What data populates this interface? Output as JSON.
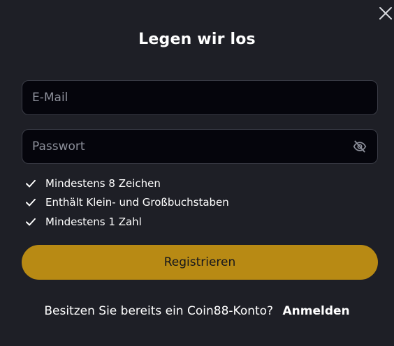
{
  "modal": {
    "title": "Legen wir los",
    "close_icon": "close-icon"
  },
  "email": {
    "placeholder": "E-Mail",
    "value": ""
  },
  "password": {
    "placeholder": "Passwort",
    "value": "",
    "toggle_icon": "eye-slash-icon"
  },
  "requirements": [
    {
      "label": "Mindestens 8 Zeichen",
      "icon": "check-icon"
    },
    {
      "label": "Enthält Klein- und Großbuchstaben",
      "icon": "check-icon"
    },
    {
      "label": "Mindestens 1 Zahl",
      "icon": "check-icon"
    }
  ],
  "register_button": {
    "label": "Registrieren"
  },
  "footer": {
    "prompt": "Besitzen Sie bereits ein Coin88-Konto?",
    "login_link": "Anmelden"
  },
  "colors": {
    "background": "#1e1f26",
    "input_background": "#05050c",
    "accent": "#b88a14"
  }
}
